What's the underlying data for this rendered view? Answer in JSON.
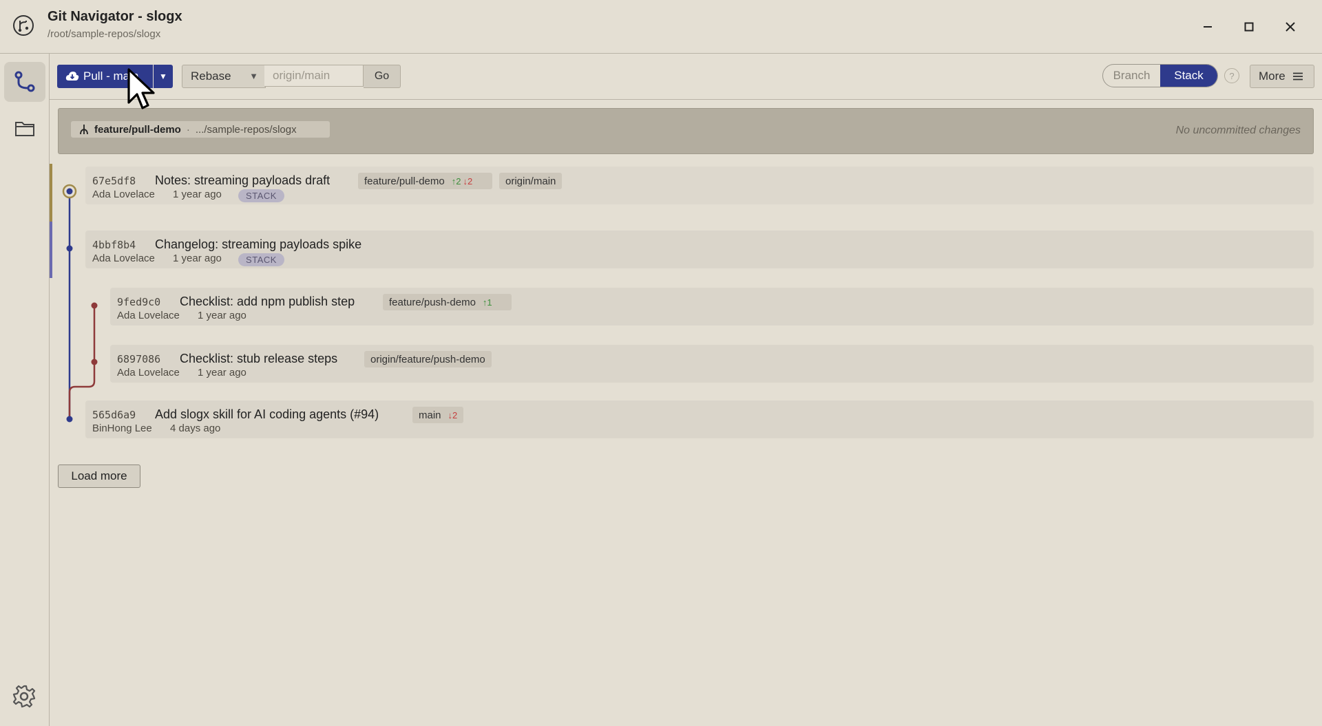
{
  "window": {
    "title": "Git Navigator - slogx",
    "path": "/root/sample-repos/slogx",
    "controls": [
      "minimize-icon",
      "maximize-icon",
      "close-icon"
    ]
  },
  "sidebar": {
    "items": [
      {
        "name": "graph",
        "icon": "git-graph-icon",
        "active": true
      },
      {
        "name": "repos",
        "icon": "folder-icon",
        "active": false
      }
    ],
    "settings_icon": "gear-icon"
  },
  "toolbar": {
    "pull_label": "Pull - main",
    "pull_icon": "cloud-download-icon",
    "mode_label": "Rebase",
    "target_placeholder": "origin/main",
    "target_value": "",
    "go_label": "Go",
    "view_options": [
      "Branch",
      "Stack"
    ],
    "view_selected": "Stack",
    "help_label": "?",
    "more_label": "More"
  },
  "status": {
    "branch": "feature/pull-demo",
    "separator": "·",
    "repo_path": ".../sample-repos/slogx",
    "changes_text": "No uncommitted changes"
  },
  "commits": [
    {
      "sha": "67e5df8",
      "message": "Notes: streaming payloads draft",
      "author": "Ada Lovelace",
      "time": "1 year ago",
      "badge": "STACK",
      "refs": [
        {
          "name": "feature/pull-demo",
          "ahead": "↑2",
          "behind": "↓2"
        },
        {
          "name": "origin/main"
        }
      ]
    },
    {
      "sha": "4bbf8b4",
      "message": "Changelog: streaming payloads spike",
      "author": "Ada Lovelace",
      "time": "1 year ago",
      "badge": "STACK",
      "refs": []
    },
    {
      "sha": "9fed9c0",
      "message": "Checklist: add npm publish step",
      "author": "Ada Lovelace",
      "time": "1 year ago",
      "refs": [
        {
          "name": "feature/push-demo",
          "ahead": "↑1"
        }
      ]
    },
    {
      "sha": "6897086",
      "message": "Checklist: stub release steps",
      "author": "Ada Lovelace",
      "time": "1 year ago",
      "refs": [
        {
          "name": "origin/feature/push-demo"
        }
      ]
    },
    {
      "sha": "565d6a9",
      "message": "Add slogx skill for AI coding agents (#94)",
      "author": "BinHong Lee",
      "time": "4 days ago",
      "refs": [
        {
          "name": "main",
          "behind": "↓2"
        }
      ]
    }
  ],
  "load_more_label": "Load more",
  "colors": {
    "accent": "#2e3a8c",
    "head_marker": "#a08a4a",
    "stack_lane": "#6b6ab0",
    "branch_lane": "#8e3a3a",
    "ahead": "#3c8f3c",
    "behind": "#c63e3e"
  }
}
